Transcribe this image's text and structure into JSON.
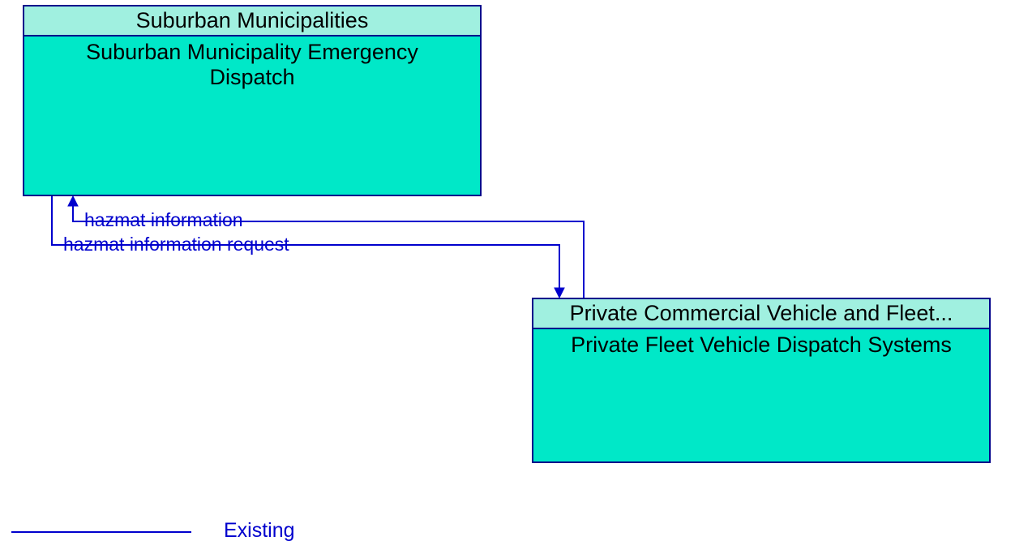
{
  "entities": {
    "top": {
      "header": "Suburban Municipalities",
      "body": "Suburban Municipality Emergency Dispatch"
    },
    "bottom": {
      "header": "Private Commercial Vehicle and Fleet...",
      "body": "Private Fleet Vehicle Dispatch Systems"
    }
  },
  "flows": {
    "toTop": "hazmat information",
    "toBottom": "hazmat information request"
  },
  "legend": {
    "existing": "Existing"
  }
}
